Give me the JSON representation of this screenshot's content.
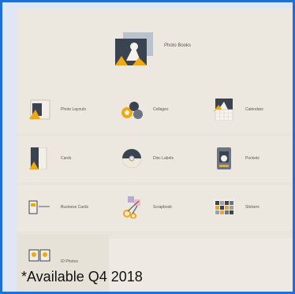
{
  "hero": {
    "label": "Photo Books"
  },
  "tiles": [
    {
      "label": "Photo Layouts"
    },
    {
      "label": "Collages"
    },
    {
      "label": "Calendars"
    },
    {
      "label": "Cards"
    },
    {
      "label": "Disc Labels"
    },
    {
      "label": "Pockets"
    },
    {
      "label": "Business Cards"
    },
    {
      "label": "Scrapbook"
    },
    {
      "label": "Stickers"
    },
    {
      "label": "ID Photos"
    }
  ],
  "footnote": "*Available Q4 2018",
  "colors": {
    "frame_border": "#1f6fd6",
    "accent": "#f0a814",
    "panel": "#e9e5dc"
  }
}
